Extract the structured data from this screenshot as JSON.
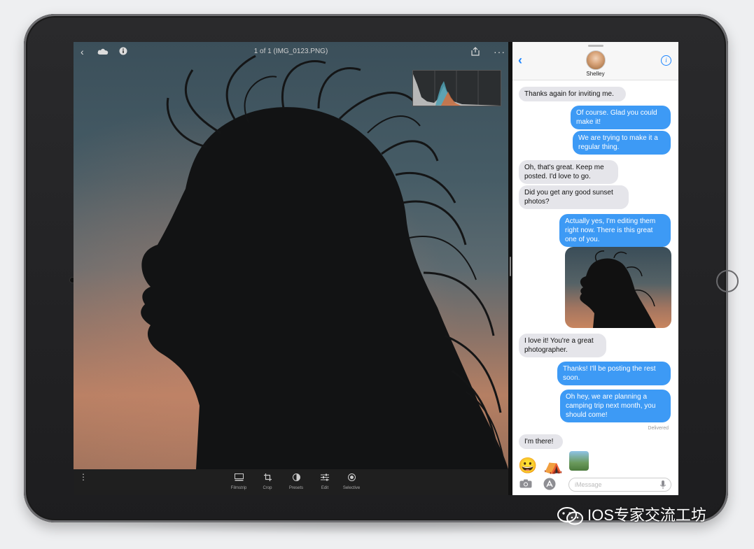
{
  "editor": {
    "title": "1 of 1 (IMG_0123.PNG)",
    "icons": [
      "back-chevron-icon",
      "cloud-icon",
      "info-icon",
      "share-icon",
      "more-icon"
    ],
    "tools": [
      {
        "label": "Filmstrip",
        "icon": "filmstrip-icon"
      },
      {
        "label": "Crop",
        "icon": "crop-icon"
      },
      {
        "label": "Presets",
        "icon": "presets-icon"
      },
      {
        "label": "Edit",
        "icon": "edit-sliders-icon"
      },
      {
        "label": "Selective",
        "icon": "selective-icon"
      }
    ]
  },
  "messages": {
    "contact_name": "Shelley",
    "thread": [
      {
        "from": "them",
        "text": "Thanks again for inviting me."
      },
      {
        "from": "me",
        "text": "Of course. Glad you could make it!"
      },
      {
        "from": "me",
        "text": "We are trying to make it a regular thing."
      },
      {
        "from": "them",
        "text": "Oh, that's great. Keep me posted. I'd love to go."
      },
      {
        "from": "them",
        "text": "Did you get any good sunset photos?"
      },
      {
        "from": "me",
        "text": "Actually yes, I'm editing them right now. There is this great one of you."
      },
      {
        "from": "them",
        "text": "I love it! You're a great photographer."
      },
      {
        "from": "me",
        "text": "Thanks! I'll be posting the rest soon."
      },
      {
        "from": "me",
        "text": "Oh hey, we are planning a camping trip next month, you should come!"
      },
      {
        "from": "them",
        "text": "I'm there!"
      }
    ],
    "delivered": "Delivered",
    "input_placeholder": "iMessage"
  },
  "watermark": "IOS专家交流工坊",
  "colors": {
    "imessage_blue": "#3d9af5",
    "incoming_gray": "#e5e5ea",
    "ios_blue": "#1a84ff"
  }
}
